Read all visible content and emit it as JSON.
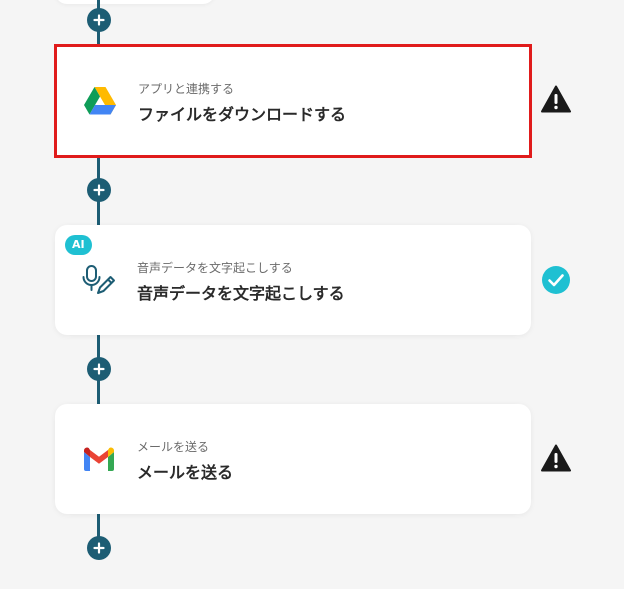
{
  "flow": {
    "steps": [
      {
        "subtitle": "アプリと連携する",
        "title": "ファイルをダウンロードする",
        "app_icon": "google-drive-icon",
        "status": "warning",
        "selected": true
      },
      {
        "badge": "AI",
        "subtitle": "音声データを文字起こしする",
        "title": "音声データを文字起こしする",
        "app_icon": "microphone-pen-icon",
        "status": "success",
        "selected": false
      },
      {
        "subtitle": "メールを送る",
        "title": "メールを送る",
        "app_icon": "gmail-icon",
        "status": "warning",
        "selected": false
      }
    ]
  },
  "colors": {
    "connector": "#1d5d74",
    "selected_border": "#e01b1b",
    "ai_badge": "#1fc0d2",
    "success": "#1fc0d2",
    "warning": "#1a1a1a"
  }
}
